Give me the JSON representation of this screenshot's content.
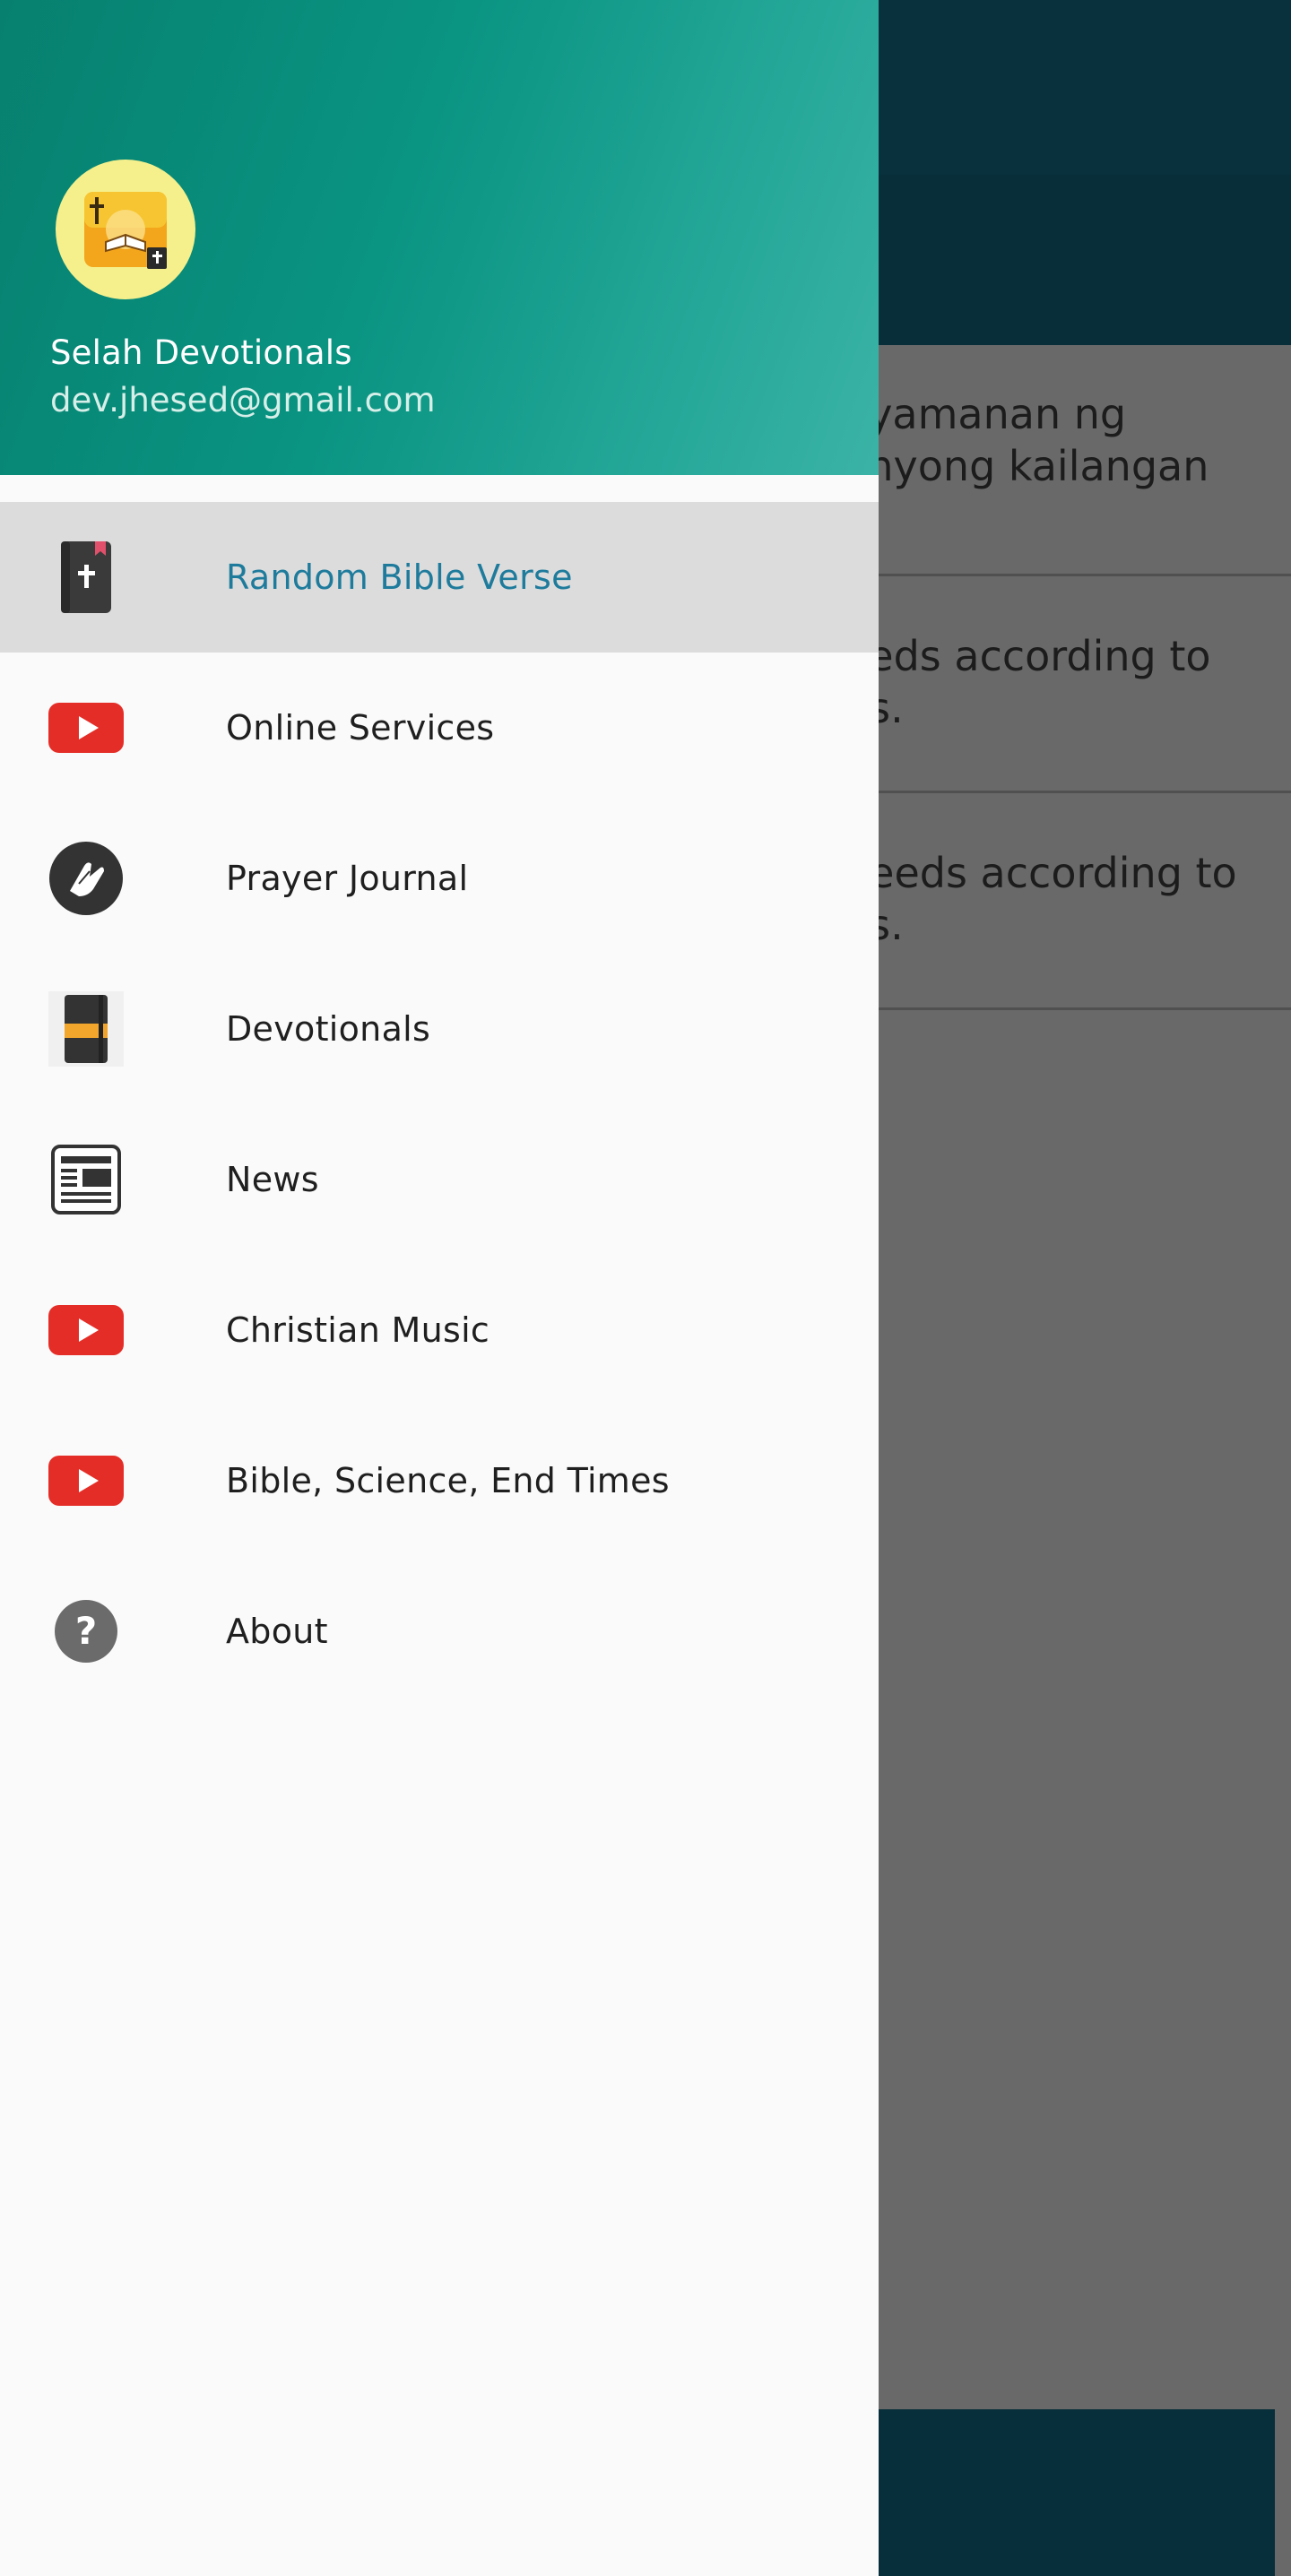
{
  "drawer": {
    "app_name": "Selah Devotionals",
    "email": "dev.jhesed@gmail.com",
    "items": [
      {
        "label": "Random Bible Verse",
        "icon": "bible-icon",
        "active": true
      },
      {
        "label": "Online Services",
        "icon": "youtube-icon",
        "active": false
      },
      {
        "label": "Prayer Journal",
        "icon": "praying-hands-icon",
        "active": false
      },
      {
        "label": "Devotionals",
        "icon": "notebook-icon",
        "active": false
      },
      {
        "label": "News",
        "icon": "newspaper-icon",
        "active": false
      },
      {
        "label": "Christian Music",
        "icon": "youtube-icon",
        "active": false
      },
      {
        "label": "Bible, Science, End Times",
        "icon": "youtube-icon",
        "active": false
      },
      {
        "label": "About",
        "icon": "help-icon",
        "active": false
      }
    ]
  },
  "background": {
    "cards": [
      {
        "text": "ayamanan ng\n inyong kailangan\ns."
      },
      {
        "text": "eeds according to\nus."
      },
      {
        "text": "needs according to\nus."
      }
    ]
  },
  "colors": {
    "header_start": "#07806f",
    "header_end": "#3bb3a6",
    "active_text": "#1e7b9c",
    "active_bg": "#dcdcdc",
    "youtube_red": "#e52d27"
  }
}
